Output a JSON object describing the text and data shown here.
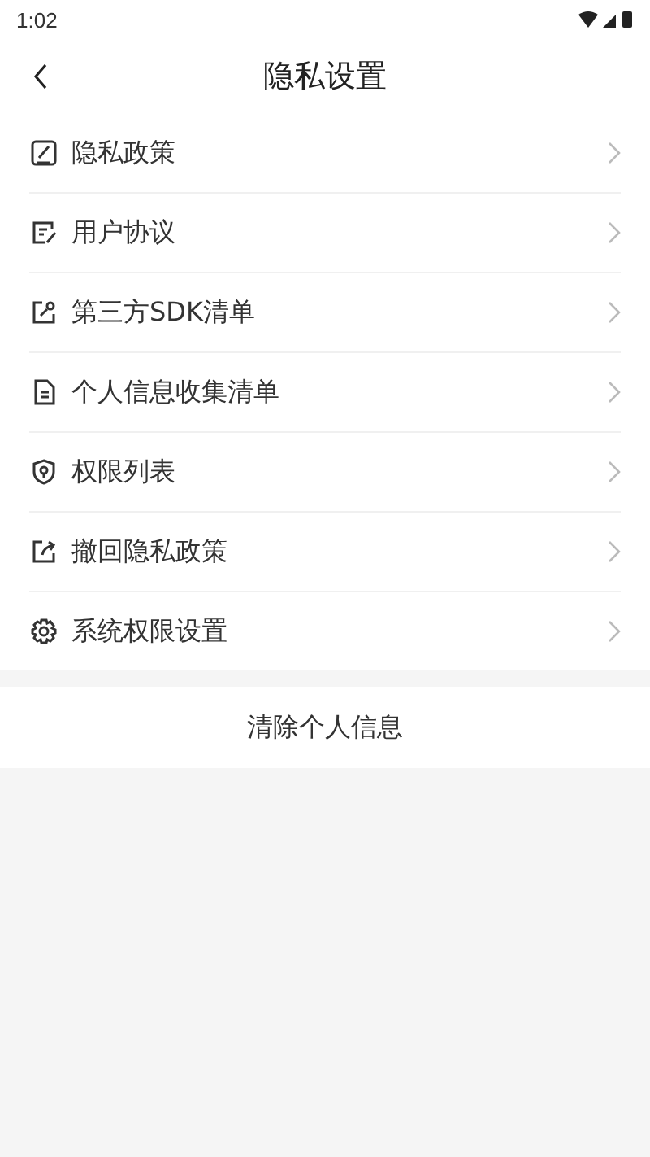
{
  "status_bar": {
    "time": "1:02"
  },
  "header": {
    "title": "隐私设置"
  },
  "items": [
    {
      "label": "隐私政策"
    },
    {
      "label": "用户协议"
    },
    {
      "label": "第三方SDK清单"
    },
    {
      "label": "个人信息收集清单"
    },
    {
      "label": "权限列表"
    },
    {
      "label": "撤回隐私政策"
    },
    {
      "label": "系统权限设置"
    }
  ],
  "clear_button": {
    "label": "清除个人信息"
  }
}
